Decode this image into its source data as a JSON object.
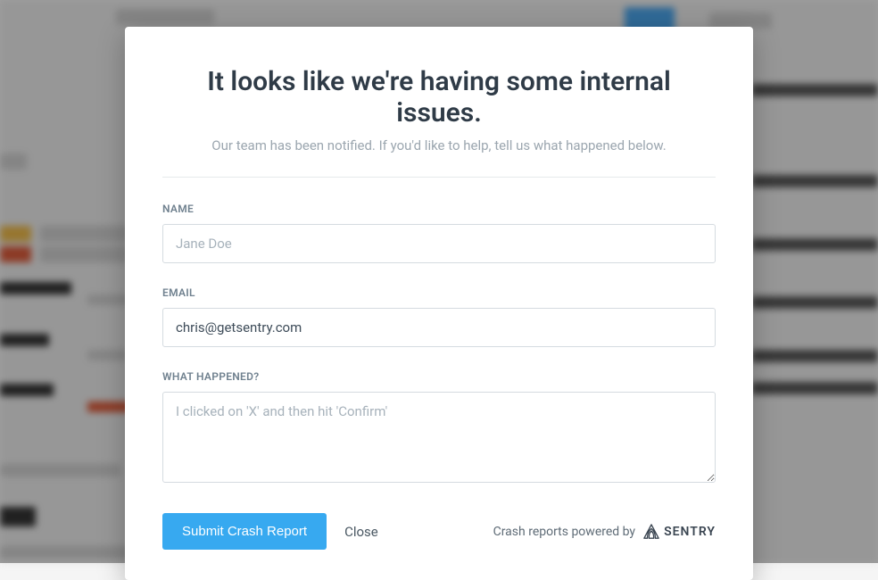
{
  "modal": {
    "title": "It looks like we're having some internal issues.",
    "subtitle": "Our team has been notified. If you'd like to help, tell us what happened below.",
    "fields": {
      "name": {
        "label": "NAME",
        "placeholder": "Jane Doe",
        "value": ""
      },
      "email": {
        "label": "EMAIL",
        "placeholder": "",
        "value": "chris@getsentry.com"
      },
      "whatHappened": {
        "label": "WHAT HAPPENED?",
        "placeholder": "I clicked on 'X' and then hit 'Confirm'",
        "value": ""
      }
    },
    "actions": {
      "submit": "Submit Crash Report",
      "close": "Close"
    },
    "footer": {
      "poweredByText": "Crash reports powered by",
      "brand": "SENTRY"
    }
  }
}
